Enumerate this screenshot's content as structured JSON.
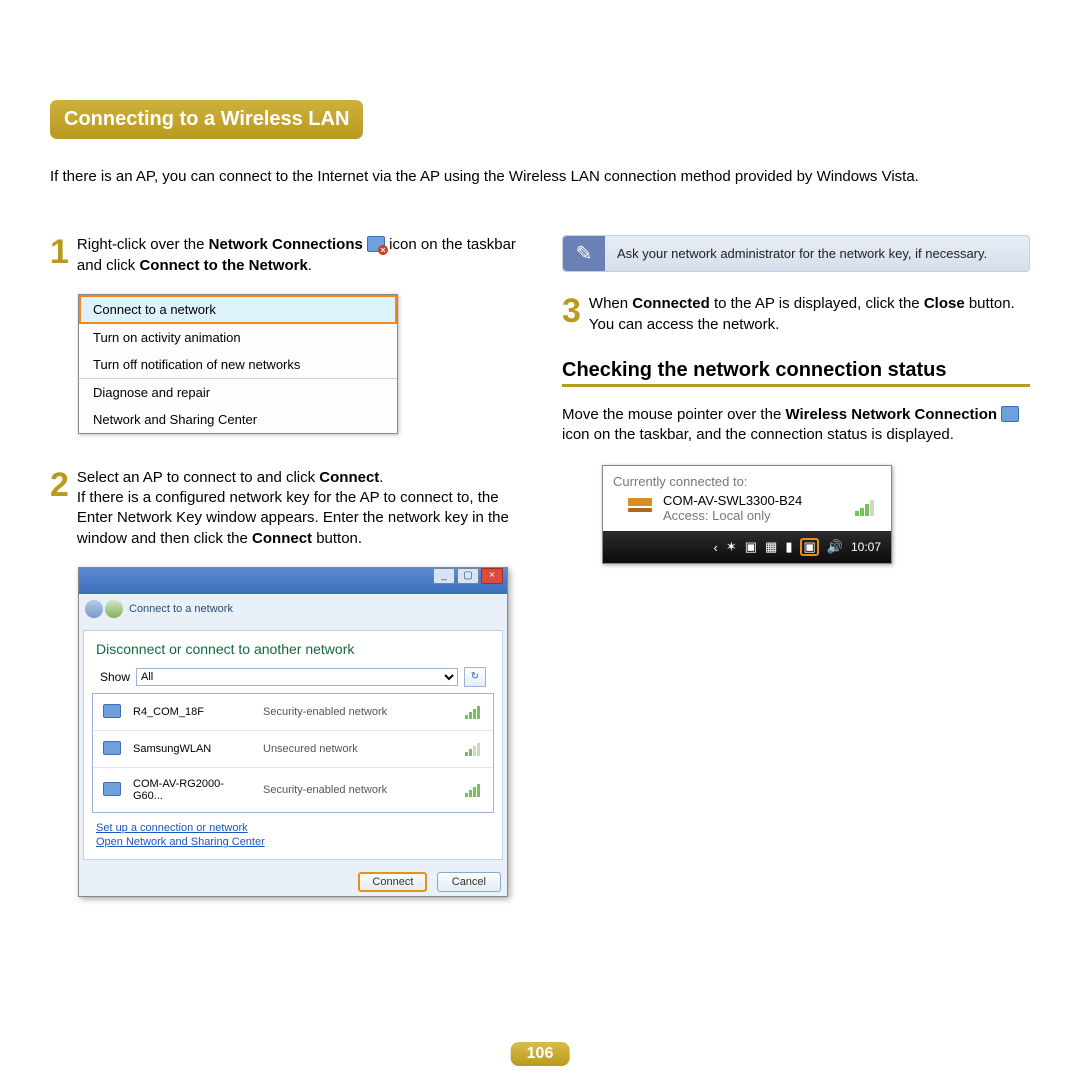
{
  "title": "Connecting to a Wireless LAN",
  "intro": "If there is an AP, you can connect to the Internet via the AP using the Wireless LAN connection method provided by Windows Vista.",
  "step1": {
    "num": "1",
    "pre": "Right-click over the ",
    "bold1": "Network Connections",
    "mid": " icon on the taskbar and click ",
    "bold2": "Connect to the Network",
    "post": "."
  },
  "ctx": {
    "i0": "Connect to a network",
    "i1": "Turn on activity animation",
    "i2": "Turn off notification of new networks",
    "i3": "Diagnose and repair",
    "i4": "Network and Sharing Center"
  },
  "step2": {
    "num": "2",
    "l1a": "Select an AP to connect to and click ",
    "l1b": "Connect",
    "l1c": ".",
    "l2a": "If there is a configured network key for the AP to connect to, the Enter Network Key window appears. Enter the network key in the window and then click the ",
    "l2b": "Connect",
    "l2c": " button."
  },
  "win": {
    "crumb": "Connect to a network",
    "heading": "Disconnect or connect to another network",
    "showLabel": "Show",
    "showValue": "All",
    "rows": [
      {
        "name": "R4_COM_18F",
        "sec": "Security-enabled network",
        "sig": "hi"
      },
      {
        "name": "SamsungWLAN",
        "sec": "Unsecured network",
        "sig": "low"
      },
      {
        "name": "COM-AV-RG2000-G60...",
        "sec": "Security-enabled network",
        "sig": "hi"
      }
    ],
    "link1": "Set up a connection or network",
    "link2": "Open Network and Sharing Center",
    "btnConnect": "Connect",
    "btnCancel": "Cancel"
  },
  "note": "Ask your network administrator for the network key, if necessary.",
  "step3": {
    "num": "3",
    "l1a": "When ",
    "l1b": "Connected",
    "l1c": " to the AP is displayed, click the ",
    "l1d": "Close",
    "l1e": " button.",
    "l2": "You can access the network."
  },
  "subhead": "Checking the network connection status",
  "checking": {
    "a": "Move the mouse pointer over the ",
    "b": "Wireless Network Connection",
    "c": " icon on the taskbar, and the connection status is displayed."
  },
  "tray": {
    "label": "Currently connected to:",
    "ssid": "COM-AV-SWL3300-B24",
    "access": "Access:  Local only",
    "time": "10:07"
  },
  "pageNum": "106",
  "icons": {
    "noteGlyph": "✎",
    "chevron": "‹",
    "refresh": "↻",
    "speaker": "🔊",
    "battery": "▮"
  }
}
